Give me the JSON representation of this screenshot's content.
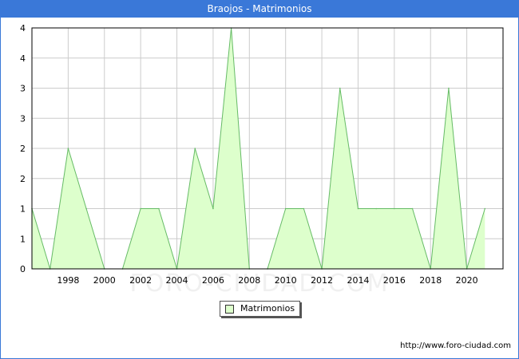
{
  "window": {
    "title": "Braojos - Matrimonios"
  },
  "legend": {
    "label": "Matrimonios"
  },
  "source": {
    "text": "http://www.foro-ciudad.com"
  },
  "watermark": {
    "text": "FORO-CIUDAD.COM"
  },
  "colors": {
    "title_bg": "#3a78d8",
    "area_fill": "#ddffcc",
    "line": "#66bb66",
    "grid": "#cccccc"
  },
  "chart_data": {
    "type": "area",
    "title": "Braojos - Matrimonios",
    "xlabel": "",
    "ylabel": "",
    "x": [
      1996,
      1997,
      1998,
      1999,
      2000,
      2001,
      2002,
      2003,
      2004,
      2005,
      2006,
      2007,
      2008,
      2009,
      2010,
      2011,
      2012,
      2013,
      2014,
      2015,
      2016,
      2017,
      2018,
      2019,
      2020,
      2021
    ],
    "series": [
      {
        "name": "Matrimonios",
        "values": [
          1,
          0,
          2,
          1,
          0,
          0,
          1,
          1,
          0,
          2,
          1,
          4,
          0,
          0,
          1,
          1,
          0,
          3,
          1,
          1,
          1,
          1,
          0,
          3,
          0,
          1
        ]
      }
    ],
    "xlim": [
      1996,
      2022
    ],
    "ylim": [
      0,
      4
    ],
    "x_ticks": [
      "1998",
      "2000",
      "2002",
      "2004",
      "2006",
      "2008",
      "2010",
      "2012",
      "2014",
      "2016",
      "2018",
      "2020"
    ],
    "y_ticks": [
      "0",
      "1",
      "1",
      "2",
      "2",
      "3",
      "3",
      "4",
      "4"
    ],
    "grid": true,
    "legend_position": "bottom-center"
  }
}
